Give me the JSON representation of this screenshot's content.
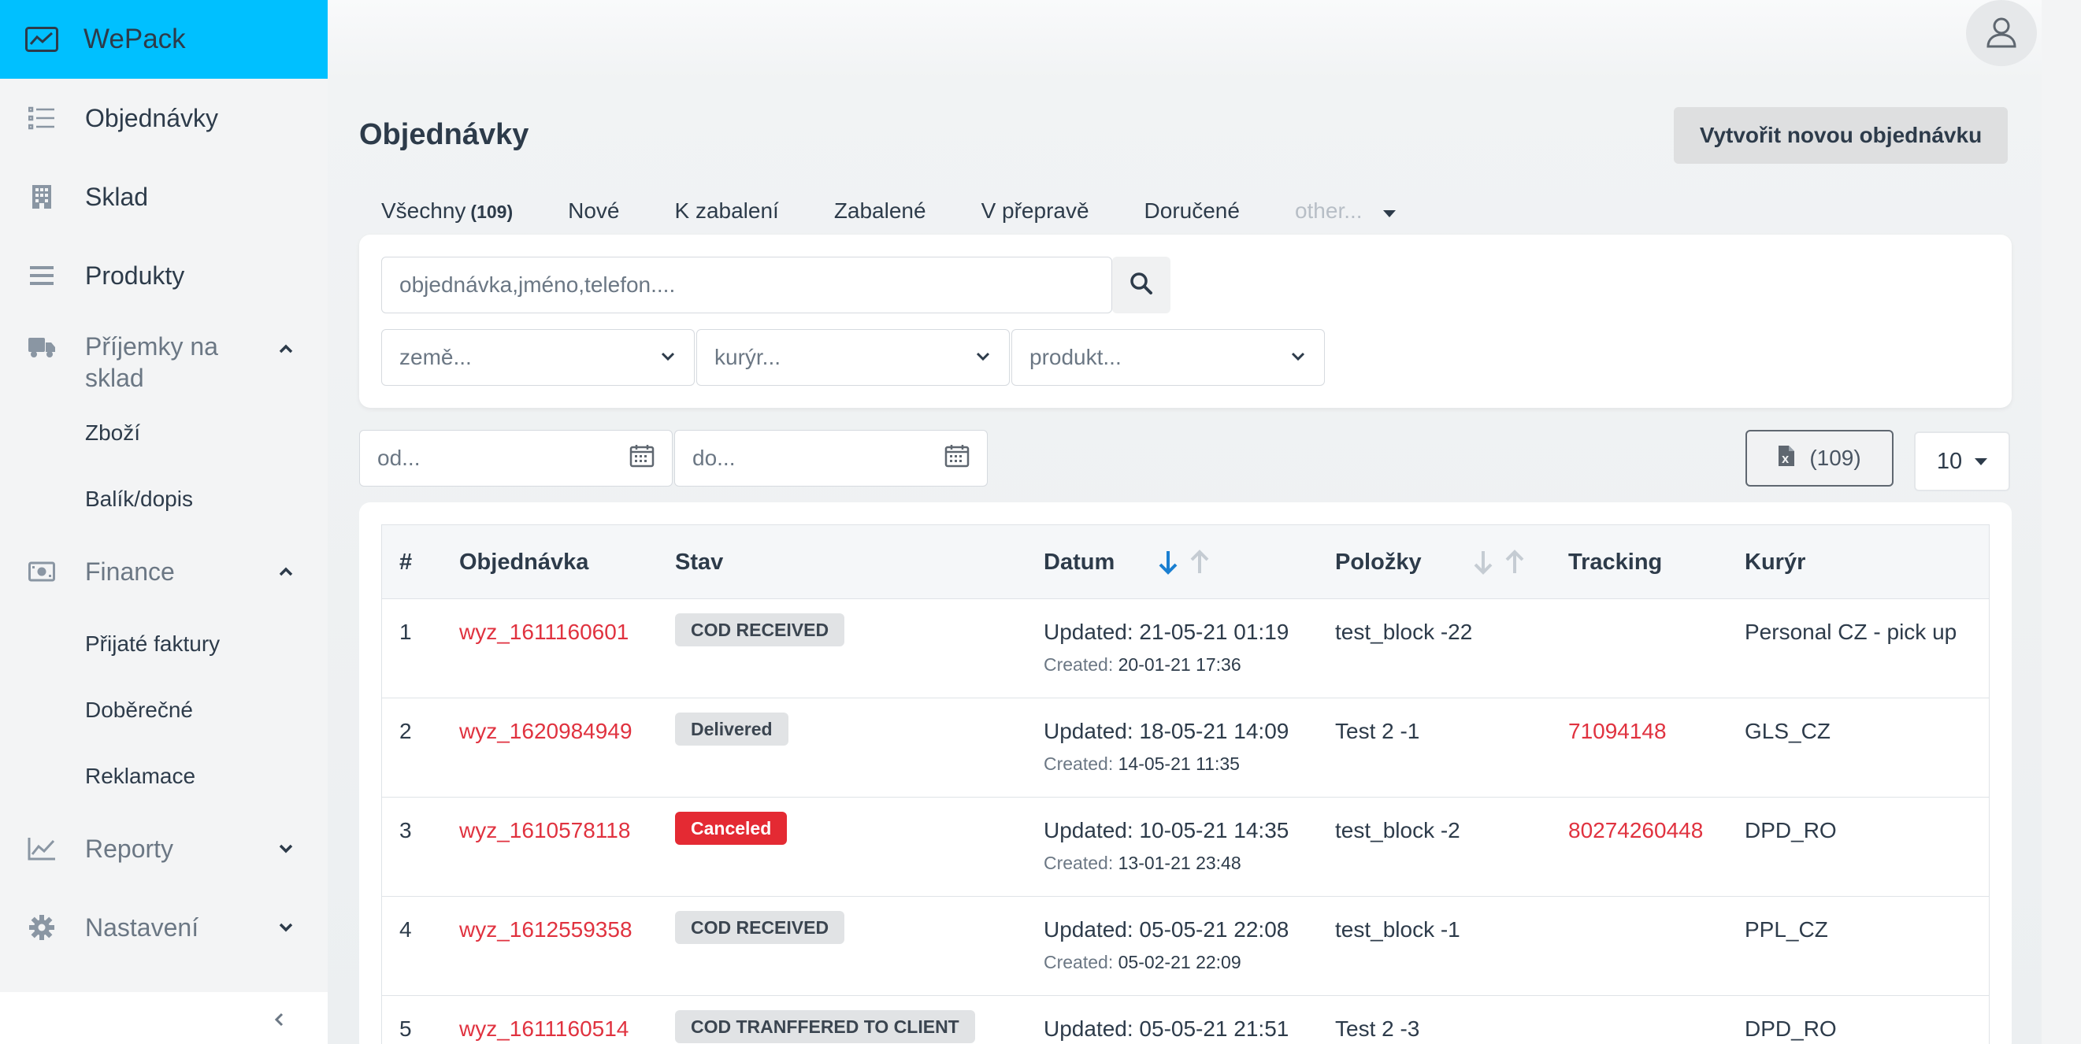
{
  "sidebar": {
    "brand": "WePack",
    "items": [
      {
        "label": "Objednávky",
        "icon": "list-icon"
      },
      {
        "label": "Sklad",
        "icon": "building-icon"
      },
      {
        "label": "Produkty",
        "icon": "menu-icon"
      },
      {
        "label": "Příjemky na sklad",
        "icon": "truck-icon",
        "expanded": true
      },
      {
        "label": "Finance",
        "icon": "money-icon",
        "expanded": true
      },
      {
        "label": "Reporty",
        "icon": "chart-line-icon",
        "expanded": false
      },
      {
        "label": "Nastavení",
        "icon": "gear-icon",
        "expanded": false
      }
    ],
    "sub_prijemky": [
      "Zboží",
      "Balík/dopis"
    ],
    "sub_finance": [
      "Přijaté faktury",
      "Doběrečné",
      "Reklamace"
    ]
  },
  "header": {
    "title": "Objednávky",
    "create_label": "Vytvořit novou objednávku"
  },
  "tabs": {
    "all_label": "Všechny",
    "all_count": "(109)",
    "items": [
      "Nové",
      "K zabalení",
      "Zabalené",
      "V přepravě",
      "Doručené"
    ],
    "other_label": "other..."
  },
  "filters": {
    "search_placeholder": "objednávka,jméno,telefon....",
    "country_placeholder": "země...",
    "courier_placeholder": "kurýr...",
    "product_placeholder": "produkt...",
    "date_from_placeholder": "od...",
    "date_to_placeholder": "do..."
  },
  "export": {
    "count": "(109)"
  },
  "per_page": "10",
  "table": {
    "headers": {
      "num": "#",
      "order": "Objednávka",
      "status": "Stav",
      "date": "Datum",
      "items": "Položky",
      "tracking": "Tracking",
      "courier": "Kurýr"
    },
    "created_prefix": "Created:",
    "rows": [
      {
        "num": "1",
        "order": "wyz_1611160601",
        "status": "COD RECEIVED",
        "status_type": "neutral",
        "updated": "Updated: 21-05-21 01:19",
        "created": "20-01-21 17:36",
        "items": "test_block -22",
        "tracking": "",
        "courier": "Personal CZ - pick up"
      },
      {
        "num": "2",
        "order": "wyz_1620984949",
        "status": "Delivered",
        "status_type": "neutral",
        "updated": "Updated: 18-05-21 14:09",
        "created": "14-05-21 11:35",
        "items": "Test 2 -1",
        "tracking": "71094148",
        "courier": "GLS_CZ"
      },
      {
        "num": "3",
        "order": "wyz_1610578118",
        "status": "Canceled",
        "status_type": "danger",
        "updated": "Updated: 10-05-21 14:35",
        "created": "13-01-21 23:48",
        "items": "test_block -2",
        "tracking": "80274260448",
        "courier": "DPD_RO"
      },
      {
        "num": "4",
        "order": "wyz_1612559358",
        "status": "COD RECEIVED",
        "status_type": "neutral",
        "updated": "Updated: 05-05-21 22:08",
        "created": "05-02-21 22:09",
        "items": "test_block -1",
        "tracking": "",
        "courier": "PPL_CZ"
      },
      {
        "num": "5",
        "order": "wyz_1611160514",
        "status": "COD TRANFFERED TO CLIENT",
        "status_type": "neutral",
        "updated": "Updated: 05-05-21 21:51",
        "created": "",
        "items": "Test 2 -3",
        "tracking": "",
        "courier": "DPD_RO"
      }
    ]
  },
  "colors": {
    "brand": "#00c0ff",
    "link": "#e0323f",
    "danger": "#e42a33",
    "sort_active": "#1a7fd1"
  }
}
